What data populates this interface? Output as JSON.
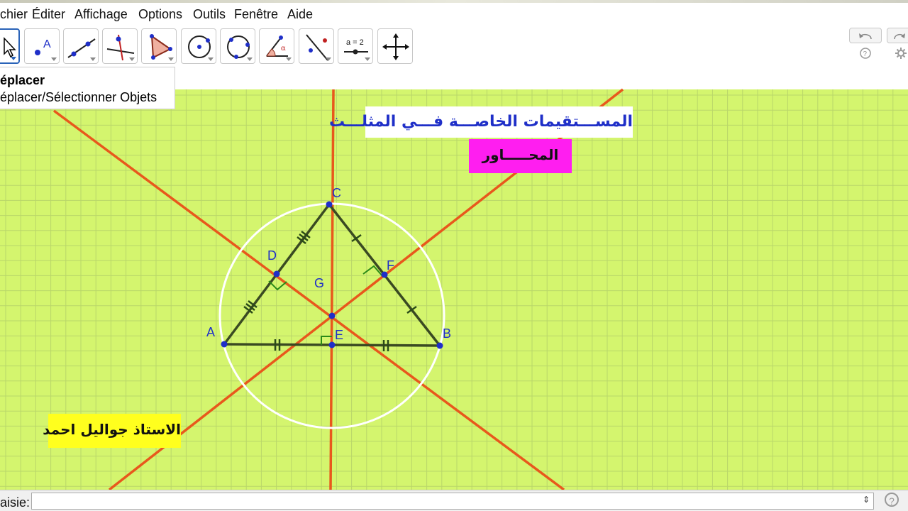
{
  "menu": {
    "items": [
      "chier",
      "Éditer",
      "Affichage",
      "Options",
      "Outils",
      "Fenêtre",
      "Aide"
    ]
  },
  "toolbar": {
    "tools": [
      {
        "icon": "move-arrow-icon",
        "active": true
      },
      {
        "icon": "new-point-icon"
      },
      {
        "icon": "line-through-two-points-icon"
      },
      {
        "icon": "perpendicular-line-icon"
      },
      {
        "icon": "polygon-icon"
      },
      {
        "icon": "circle-center-point-icon"
      },
      {
        "icon": "circle-three-points-icon"
      },
      {
        "icon": "angle-icon"
      },
      {
        "icon": "reflect-about-line-icon"
      },
      {
        "icon": "slider-icon",
        "text": "a = 2"
      },
      {
        "icon": "move-graphics-view-icon"
      }
    ],
    "undo_icon": "undo-icon",
    "redo_icon": "redo-icon"
  },
  "tooltip": {
    "title": "éplacer",
    "description": "éplacer/Sélectionner Objets"
  },
  "graphics": {
    "background_color": "#d4f56e",
    "grid_color": "#b9d66a",
    "line_color": "#e8581c",
    "triangle_color": "#3a4a22",
    "circle_color": "#ffffff",
    "point_color": "#1f2fc8",
    "title_text": "المســـتقيمات الخاصـــة فـــي المثلـــث",
    "subtitle_text": "المحـــــاور",
    "author_text": "الاستاذ جواليل احمد",
    "points": {
      "A": "A",
      "B": "B",
      "C": "C",
      "D": "D",
      "E": "E",
      "F": "F",
      "G": "G"
    }
  },
  "inputbar": {
    "label": "aisie:",
    "value": "",
    "help": "?"
  }
}
